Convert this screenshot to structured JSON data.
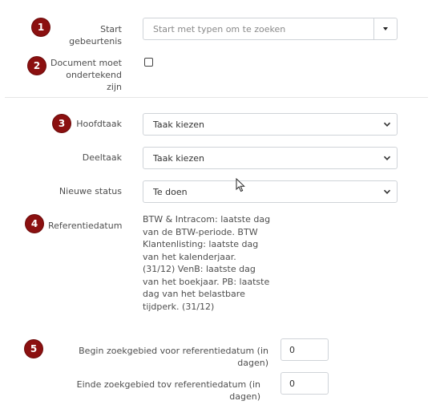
{
  "rows": {
    "start": {
      "badge": "1",
      "label": "Start gebeurtenis",
      "placeholder": "Start met typen om te zoeken"
    },
    "document": {
      "badge": "2",
      "label_line1": "Document moet",
      "label_line2": "ondertekend zijn"
    },
    "hoofdtaak": {
      "badge": "3",
      "label": "Hoofdtaak",
      "value": "Taak kiezen"
    },
    "deeltaak": {
      "label": "Deeltaak",
      "value": "Taak kiezen"
    },
    "status": {
      "label": "Nieuwe status",
      "value": "Te doen"
    },
    "referentie": {
      "badge": "4",
      "label": "Referentiedatum",
      "lines": [
        "BTW & Intracom: laatste dag",
        "van de BTW-periode. BTW",
        "Klantenlisting: laatste dag",
        "van het kalenderjaar.",
        "(31/12) VenB: laatste dag",
        "van het boekjaar. PB: laatste",
        "dag van het belastbare",
        "tijdperk. (31/12)"
      ]
    },
    "begin": {
      "badge": "5",
      "label": "Begin zoekgebied voor referentiedatum (in dagen)",
      "value": "0"
    },
    "einde": {
      "label": "Einde zoekgebied tov referentiedatum (in dagen)",
      "value": "0"
    }
  },
  "icons": {
    "combo": "caret-down-icon",
    "select": "chevron-down-icon",
    "cursor": "mouse-pointer-icon"
  },
  "colors": {
    "badge": "#8b1010",
    "border": "#cfd3d8"
  }
}
